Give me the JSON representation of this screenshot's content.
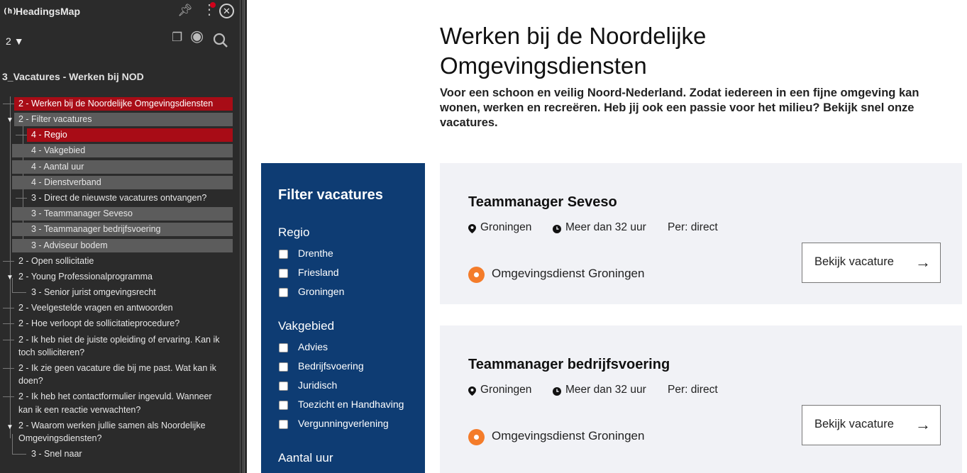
{
  "extension": {
    "logo": "(h)",
    "title": "HeadingsMap",
    "level_select": "2",
    "document_title": "3_Vacatures - Werken bij NOD",
    "icons": [
      "pin-icon",
      "more-vert-icon",
      "close-icon",
      "copy-icon",
      "eye-icon",
      "search-icon"
    ],
    "notification_color": "#d0021b",
    "tree": [
      {
        "label": "2 - Werken bij de Noordelijke Omgevingsdiensten"
      },
      {
        "label": "2 - Filter vacatures"
      },
      {
        "label": "4 - Regio"
      },
      {
        "label": "4 - Vakgebied"
      },
      {
        "label": "4 - Aantal uur"
      },
      {
        "label": "4 - Dienstverband"
      },
      {
        "label": "3 - Direct de nieuwste vacatures ontvangen?"
      },
      {
        "label": "3 - Teammanager Seveso"
      },
      {
        "label": "3 - Teammanager bedrijfsvoering"
      },
      {
        "label": "3 - Adviseur bodem"
      },
      {
        "label": "2 - Open sollicitatie"
      },
      {
        "label": "2 - Young Professionalprogramma"
      },
      {
        "label": "3 - Senior jurist omgevingsrecht"
      },
      {
        "label": "2 - Veelgestelde vragen en antwoorden"
      },
      {
        "label": "2 - Hoe verloopt de sollicitatieprocedure?"
      },
      {
        "label": "2 - Ik heb niet de juiste opleiding of ervaring. Kan ik"
      },
      {
        "label": "toch solliciteren?"
      },
      {
        "label": "2 - Ik zie geen vacature die bij me past. Wat kan ik"
      },
      {
        "label": "doen?"
      },
      {
        "label": "2 - Ik heb het contactformulier ingevuld. Wanneer"
      },
      {
        "label": "kan ik een reactie verwachten?"
      },
      {
        "label": "2 - Waarom werken jullie samen als Noordelijke"
      },
      {
        "label": "Omgevingsdiensten?"
      },
      {
        "label": "3 - Snel naar"
      }
    ],
    "colors": {
      "error": "#a80c16",
      "warning": "#5c5c5c"
    }
  },
  "page": {
    "title_line1": "Werken bij de Noordelijke",
    "title_line2": "Omgevingsdiensten",
    "intro": "Voor een schoon en veilig Noord-Nederland. Zodat iedereen in een fijne omgeving kan wonen, werken en recreëren. Heb jij ook een passie voor het milieu? Bekijk snel onze vacatures.",
    "filter": {
      "title": "Filter vacatures",
      "groups": [
        {
          "title": "Regio",
          "options": [
            "Drenthe",
            "Friesland",
            "Groningen"
          ]
        },
        {
          "title": "Vakgebied",
          "options": [
            "Advies",
            "Bedrijfsvoering",
            "Juridisch",
            "Toezicht en Handhaving",
            "Vergunningverlening"
          ]
        },
        {
          "title": "Aantal uur",
          "options": []
        }
      ],
      "color": "#0e3c73"
    },
    "jobs": [
      {
        "title": "Teammanager Seveso",
        "location": "Groningen",
        "hours": "Meer dan 32 uur",
        "start": "Per: direct",
        "organisation": "Omgevingsdienst Groningen",
        "button": "Bekijk vacature"
      },
      {
        "title": "Teammanager bedrijfsvoering",
        "location": "Groningen",
        "hours": "Meer dan 32 uur",
        "start": "Per: direct",
        "organisation": "Omgevingsdienst Groningen",
        "button": "Bekijk vacature"
      }
    ],
    "accent_color": "#f47c2a"
  }
}
